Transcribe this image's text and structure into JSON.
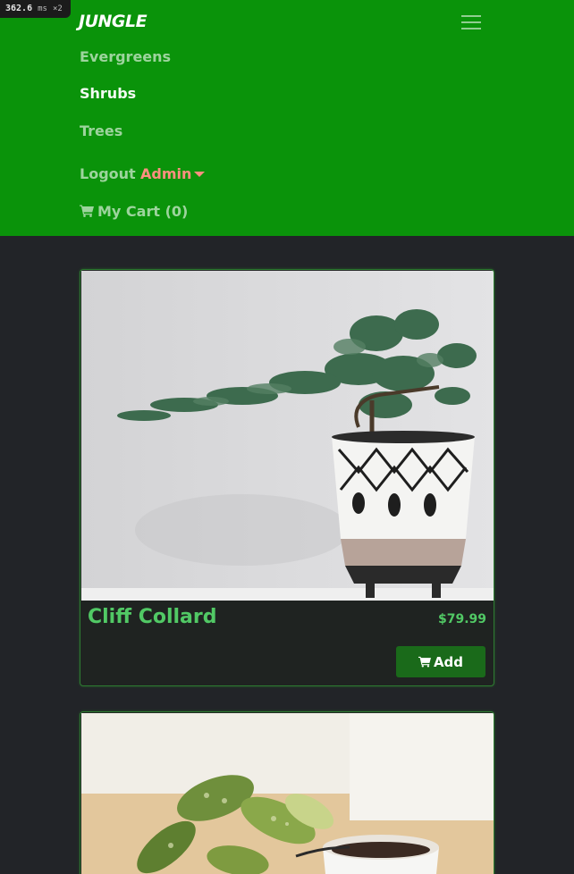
{
  "perf": {
    "value": "362.6",
    "unit": "ms",
    "mult": "×2"
  },
  "navbar": {
    "brand": "JUNGLE",
    "links": [
      "Evergreens",
      "Shrubs",
      "Trees"
    ],
    "logout": "Logout",
    "admin": "Admin",
    "cart": "My Cart (0)"
  },
  "products": [
    {
      "name": "Cliff Collard",
      "price": "$79.99",
      "add_label": "Add"
    }
  ],
  "colors": {
    "navbar_bg": "#0a930a",
    "page_bg": "#222428",
    "accent_green": "#51c965",
    "admin_link": "#ff8f80",
    "button_bg": "#1a6a1a"
  },
  "icons": [
    "hamburger-menu-icon",
    "cart-icon",
    "dropdown-caret-icon"
  ]
}
